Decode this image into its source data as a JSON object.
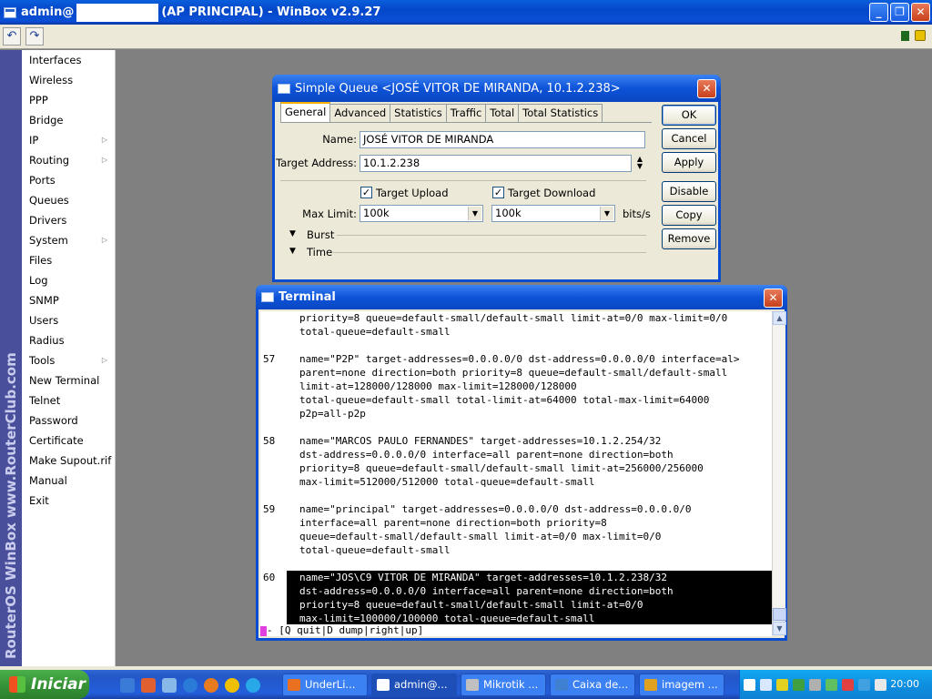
{
  "main_window": {
    "title_prefix": "admin@",
    "title_suffix": "(AP PRINCIPAL) - WinBox v2.9.27",
    "min_glyph": "_",
    "max_glyph": "❐",
    "close_glyph": "✕"
  },
  "toolbar": {
    "undo_glyph": "↶",
    "redo_glyph": "↷"
  },
  "brand_text": "RouterOS WinBox   www.RouterClub.com",
  "menu": [
    {
      "label": "Interfaces",
      "submenu": false
    },
    {
      "label": "Wireless",
      "submenu": false
    },
    {
      "label": "PPP",
      "submenu": false
    },
    {
      "label": "Bridge",
      "submenu": false
    },
    {
      "label": "IP",
      "submenu": true
    },
    {
      "label": "Routing",
      "submenu": true
    },
    {
      "label": "Ports",
      "submenu": false
    },
    {
      "label": "Queues",
      "submenu": false
    },
    {
      "label": "Drivers",
      "submenu": false
    },
    {
      "label": "System",
      "submenu": true
    },
    {
      "label": "Files",
      "submenu": false
    },
    {
      "label": "Log",
      "submenu": false
    },
    {
      "label": "SNMP",
      "submenu": false
    },
    {
      "label": "Users",
      "submenu": false
    },
    {
      "label": "Radius",
      "submenu": false
    },
    {
      "label": "Tools",
      "submenu": true
    },
    {
      "label": "New Terminal",
      "submenu": false
    },
    {
      "label": "Telnet",
      "submenu": false
    },
    {
      "label": "Password",
      "submenu": false
    },
    {
      "label": "Certificate",
      "submenu": false
    },
    {
      "label": "Make Supout.rif",
      "submenu": false
    },
    {
      "label": "Manual",
      "submenu": false
    },
    {
      "label": "Exit",
      "submenu": false
    }
  ],
  "queue_dialog": {
    "title": "Simple Queue <JOSÉ VITOR DE MIRANDA, 10.1.2.238>",
    "tabs": [
      "General",
      "Advanced",
      "Statistics",
      "Traffic",
      "Total",
      "Total Statistics"
    ],
    "name_label": "Name:",
    "name_value": "JOSÉ VITOR DE MIRANDA",
    "target_label": "Target Address:",
    "target_value": "10.1.2.238",
    "target_upload_label": "Target Upload",
    "target_download_label": "Target Download",
    "check_mark": "✓",
    "maxlimit_label": "Max Limit:",
    "maxlimit_upload": "100k",
    "maxlimit_download": "100k",
    "unit": "bits/s",
    "burst_label": "Burst",
    "time_label": "Time",
    "buttons": {
      "ok": "OK",
      "cancel": "Cancel",
      "apply": "Apply",
      "disable": "Disable",
      "copy": "Copy",
      "remove": "Remove"
    }
  },
  "terminal": {
    "title": "Terminal",
    "lines": [
      {
        "num": "",
        "text": "priority=8 queue=default-small/default-small limit-at=0/0 max-limit=0/0"
      },
      {
        "num": "",
        "text": "total-queue=default-small"
      },
      {
        "num": "",
        "text": ""
      },
      {
        "num": "57",
        "text": "name=\"P2P\" target-addresses=0.0.0.0/0 dst-address=0.0.0.0/0 interface=al>"
      },
      {
        "num": "",
        "text": "parent=none direction=both priority=8 queue=default-small/default-small"
      },
      {
        "num": "",
        "text": "limit-at=128000/128000 max-limit=128000/128000"
      },
      {
        "num": "",
        "text": "total-queue=default-small total-limit-at=64000 total-max-limit=64000"
      },
      {
        "num": "",
        "text": "p2p=all-p2p"
      },
      {
        "num": "",
        "text": ""
      },
      {
        "num": "58",
        "text": "name=\"MARCOS PAULO FERNANDES\" target-addresses=10.1.2.254/32"
      },
      {
        "num": "",
        "text": "dst-address=0.0.0.0/0 interface=all parent=none direction=both"
      },
      {
        "num": "",
        "text": "priority=8 queue=default-small/default-small limit-at=256000/256000"
      },
      {
        "num": "",
        "text": "max-limit=512000/512000 total-queue=default-small"
      },
      {
        "num": "",
        "text": ""
      },
      {
        "num": "59",
        "text": "name=\"principal\" target-addresses=0.0.0.0/0 dst-address=0.0.0.0/0"
      },
      {
        "num": "",
        "text": "interface=all parent=none direction=both priority=8"
      },
      {
        "num": "",
        "text": "queue=default-small/default-small limit-at=0/0 max-limit=0/0"
      },
      {
        "num": "",
        "text": "total-queue=default-small"
      },
      {
        "num": "",
        "text": ""
      },
      {
        "num": "60",
        "text": "name=\"JOS\\C9 VITOR DE MIRANDA\" target-addresses=10.1.2.238/32",
        "highlight": true
      },
      {
        "num": "",
        "text": "dst-address=0.0.0.0/0 interface=all parent=none direction=both",
        "highlight": true
      },
      {
        "num": "",
        "text": "priority=8 queue=default-small/default-small limit-at=0/0",
        "highlight": true
      },
      {
        "num": "",
        "text": "max-limit=100000/100000 total-queue=default-small",
        "highlight": true
      }
    ],
    "status": "- [Q quit|D dump|right|up]",
    "scroll_up": "▲",
    "scroll_down": "▼"
  },
  "taskbar": {
    "start_label": "Iniciar",
    "tasks": [
      "UnderLi...",
      "admin@...",
      "Mikrotik ...",
      "Caixa de...",
      "imagem ..."
    ],
    "active_task_index": 1,
    "clock": "20:00"
  },
  "colors": {
    "xp_blue": "#0a4cd0",
    "terminal_highlight": "#000000",
    "cursor": "#e040e0",
    "brand_strip": "#4a4f9c"
  }
}
